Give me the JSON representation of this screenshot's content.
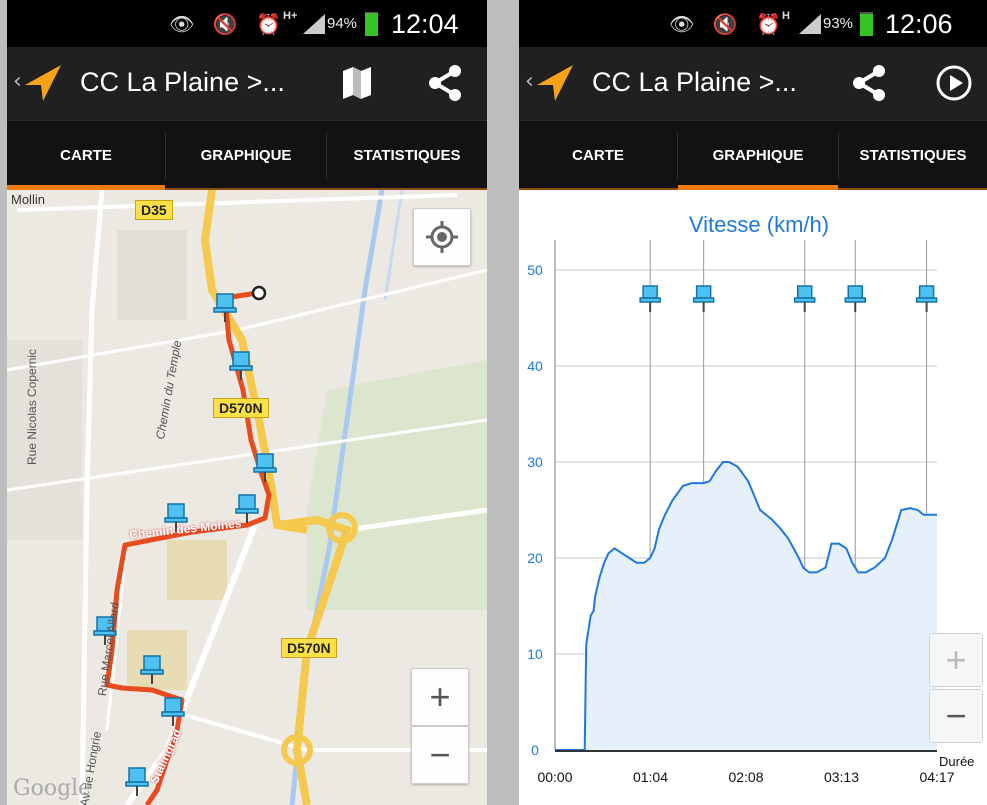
{
  "left": {
    "status": {
      "battery": "94%",
      "time": "12:04",
      "network": "H+",
      "icons": "👁 🔇 ⏰"
    },
    "actionbar": {
      "title": "CC La Plaine >...",
      "back": "‹"
    },
    "tabs": [
      {
        "label": "CARTE"
      },
      {
        "label": "GRAPHIQUE"
      },
      {
        "label": "STATISTIQUES"
      }
    ],
    "map": {
      "place_mollin": "Mollin",
      "shield_d35": "D35",
      "shield_d570n_1": "D570N",
      "shield_d570n_2": "D570N",
      "street_copernic": "Rue Nicolas Copernic",
      "street_temple": "Chemin du Temple",
      "street_moines": "Chemin des Moines",
      "street_allard": "Rue Marcel Allard",
      "street_hongrie": "Av de Hongrie",
      "street_stalingrad": "Stalingrad",
      "zoom_in": "+",
      "zoom_out": "−",
      "google": "Google"
    }
  },
  "right": {
    "status": {
      "battery": "93%",
      "time": "12:06",
      "network": "H",
      "icons": "👁 🔇 ⏰"
    },
    "actionbar": {
      "title": "CC La Plaine >...",
      "back": "‹"
    },
    "tabs": [
      {
        "label": "CARTE"
      },
      {
        "label": "GRAPHIQUE"
      },
      {
        "label": "STATISTIQUES"
      }
    ],
    "zoom": {
      "in": "+",
      "out": "−"
    }
  },
  "chart_data": {
    "type": "area",
    "title": "Vitesse (km/h)",
    "xlabel": "Durée",
    "ylabel": "",
    "ylim": [
      0,
      50
    ],
    "yticks": [
      "0",
      "10",
      "20",
      "30",
      "40",
      "50"
    ],
    "xtick_labels": [
      "00:00",
      "01:04",
      "02:08",
      "03:13",
      "04:17"
    ],
    "xlim_minutes": [
      0,
      257
    ],
    "marker_x_minutes": [
      64,
      100,
      168,
      202,
      250
    ],
    "series": [
      {
        "name": "",
        "color": "#1f78e0",
        "x": [
          0,
          5,
          10,
          15,
          20,
          21,
          22,
          24,
          26,
          27,
          30,
          33,
          36,
          40,
          45,
          50,
          55,
          60,
          64,
          67,
          70,
          74,
          79,
          86,
          92,
          100,
          104,
          108,
          113,
          117,
          123,
          130,
          138,
          146,
          152,
          157,
          164,
          167,
          171,
          176,
          182,
          186,
          191,
          196,
          200,
          204,
          209,
          215,
          222,
          227,
          233,
          239,
          244,
          248,
          251,
          254,
          257
        ],
        "y": [
          0,
          0,
          0,
          0,
          0,
          11,
          12,
          14,
          14.5,
          16,
          18,
          19.5,
          20.5,
          21,
          20.5,
          20,
          19.5,
          19.5,
          20,
          21,
          23,
          24.5,
          26,
          27.5,
          27.8,
          27.8,
          28,
          29,
          30,
          30,
          29.5,
          28,
          25,
          24,
          23,
          22,
          20,
          19,
          18.5,
          18.5,
          19,
          21.5,
          21.5,
          21,
          19.5,
          18.5,
          18.5,
          19,
          20,
          22,
          25,
          25.2,
          25,
          24.5,
          24.5,
          24.5,
          24.5
        ]
      }
    ]
  }
}
